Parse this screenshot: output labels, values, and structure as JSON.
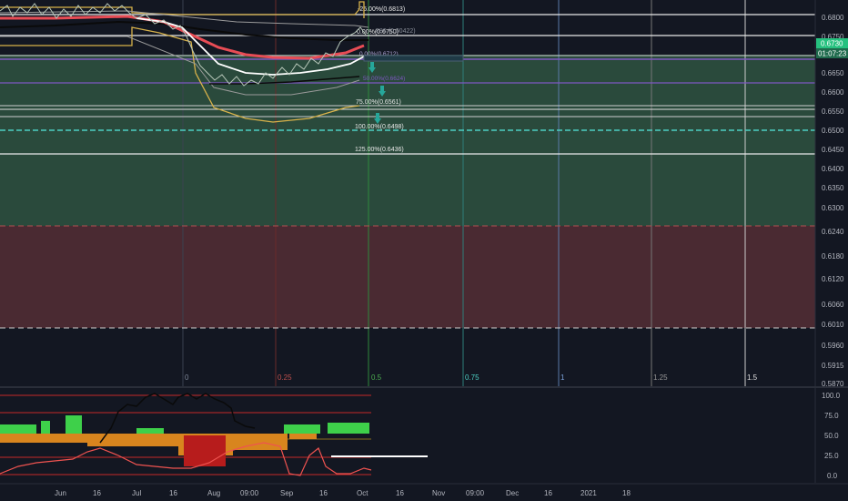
{
  "colors": {
    "background": "#131722",
    "green_zone": "#2a4a3c",
    "red_zone": "#4a2a32",
    "last_price_bg": "#26c17f",
    "timer_bg": "#1f6b4d",
    "fib_white": "#e8e8e8",
    "fib_purple": "#7e57c2",
    "fib_teal": "#4dd0c4",
    "band_yellow": "#d8b24a",
    "ma_red": "#e84c55",
    "ma_black": "#0a0a0a",
    "osc_green": "#3ed04a",
    "osc_orange": "#d8851e",
    "osc_red": "#b71c1c",
    "osc_red_line": "#ef5350"
  },
  "price_scale": {
    "ticks": [
      "0.6800",
      "0.6750",
      "0.6700",
      "0.6650",
      "0.6600",
      "0.6550",
      "0.6500",
      "0.6450",
      "0.6400",
      "0.6350",
      "0.6300",
      "0.6240",
      "0.6180",
      "0.6120",
      "0.6060",
      "0.6010",
      "0.5960",
      "0.5915",
      "0.5870"
    ],
    "last_price": "0.6730",
    "countdown": "01:07:23"
  },
  "fib_levels": [
    {
      "label": "-25.00%(0.6813)",
      "price": 0.6813
    },
    {
      "label": "0.00%(0.6750)",
      "price": 0.675
    },
    {
      "label": "75.00%(0.6561)",
      "price": 0.6561
    },
    {
      "label": "100.00%(0.6498)",
      "price": 0.6498
    },
    {
      "label": "125.00%(0.6436)",
      "price": 0.6436
    }
  ],
  "fib_faded_labels": [
    {
      "label": "0.00%(0.6712)",
      "price": 0.6713
    },
    {
      "label": "50.00%(0.6624)",
      "price": 0.6624
    }
  ],
  "extra_label": "886 (0.00422)",
  "fib_time_labels": [
    "0",
    "0.25",
    "0.5",
    "0.75",
    "1",
    "1.25",
    "1.5"
  ],
  "oscillator": {
    "ticks": [
      "100.0",
      "75.0",
      "50.0",
      "25.0",
      "0.0"
    ],
    "levels": [
      100,
      75,
      50,
      25,
      0
    ]
  },
  "time_axis": [
    "Jun",
    "16",
    "Jul",
    "16",
    "Aug",
    "09:00",
    "Sep",
    "16",
    "Oct",
    "16",
    "Nov",
    "09:00",
    "Dec",
    "16",
    "2021",
    "18"
  ]
}
